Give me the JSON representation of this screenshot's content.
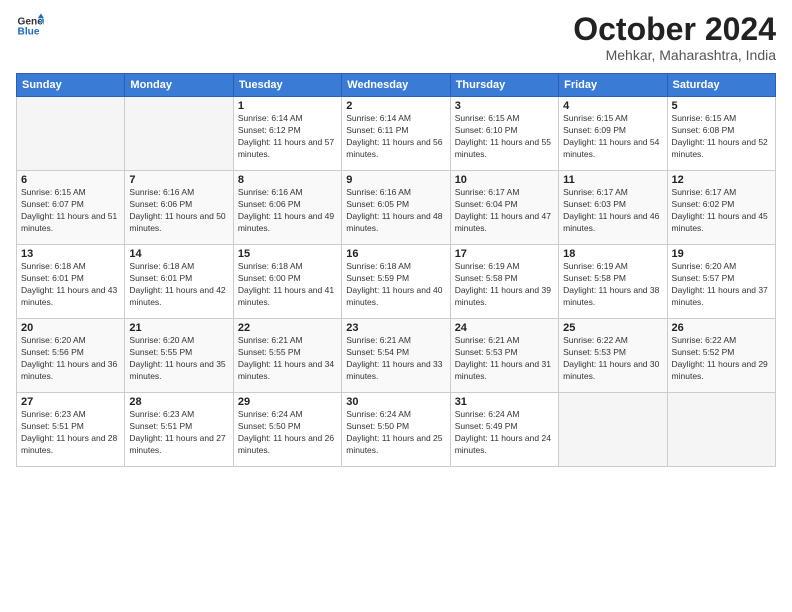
{
  "header": {
    "logo_line1": "General",
    "logo_line2": "Blue",
    "month": "October 2024",
    "location": "Mehkar, Maharashtra, India"
  },
  "weekdays": [
    "Sunday",
    "Monday",
    "Tuesday",
    "Wednesday",
    "Thursday",
    "Friday",
    "Saturday"
  ],
  "weeks": [
    [
      {
        "day": "",
        "info": ""
      },
      {
        "day": "",
        "info": ""
      },
      {
        "day": "1",
        "info": "Sunrise: 6:14 AM\nSunset: 6:12 PM\nDaylight: 11 hours and 57 minutes."
      },
      {
        "day": "2",
        "info": "Sunrise: 6:14 AM\nSunset: 6:11 PM\nDaylight: 11 hours and 56 minutes."
      },
      {
        "day": "3",
        "info": "Sunrise: 6:15 AM\nSunset: 6:10 PM\nDaylight: 11 hours and 55 minutes."
      },
      {
        "day": "4",
        "info": "Sunrise: 6:15 AM\nSunset: 6:09 PM\nDaylight: 11 hours and 54 minutes."
      },
      {
        "day": "5",
        "info": "Sunrise: 6:15 AM\nSunset: 6:08 PM\nDaylight: 11 hours and 52 minutes."
      }
    ],
    [
      {
        "day": "6",
        "info": "Sunrise: 6:15 AM\nSunset: 6:07 PM\nDaylight: 11 hours and 51 minutes."
      },
      {
        "day": "7",
        "info": "Sunrise: 6:16 AM\nSunset: 6:06 PM\nDaylight: 11 hours and 50 minutes."
      },
      {
        "day": "8",
        "info": "Sunrise: 6:16 AM\nSunset: 6:06 PM\nDaylight: 11 hours and 49 minutes."
      },
      {
        "day": "9",
        "info": "Sunrise: 6:16 AM\nSunset: 6:05 PM\nDaylight: 11 hours and 48 minutes."
      },
      {
        "day": "10",
        "info": "Sunrise: 6:17 AM\nSunset: 6:04 PM\nDaylight: 11 hours and 47 minutes."
      },
      {
        "day": "11",
        "info": "Sunrise: 6:17 AM\nSunset: 6:03 PM\nDaylight: 11 hours and 46 minutes."
      },
      {
        "day": "12",
        "info": "Sunrise: 6:17 AM\nSunset: 6:02 PM\nDaylight: 11 hours and 45 minutes."
      }
    ],
    [
      {
        "day": "13",
        "info": "Sunrise: 6:18 AM\nSunset: 6:01 PM\nDaylight: 11 hours and 43 minutes."
      },
      {
        "day": "14",
        "info": "Sunrise: 6:18 AM\nSunset: 6:01 PM\nDaylight: 11 hours and 42 minutes."
      },
      {
        "day": "15",
        "info": "Sunrise: 6:18 AM\nSunset: 6:00 PM\nDaylight: 11 hours and 41 minutes."
      },
      {
        "day": "16",
        "info": "Sunrise: 6:18 AM\nSunset: 5:59 PM\nDaylight: 11 hours and 40 minutes."
      },
      {
        "day": "17",
        "info": "Sunrise: 6:19 AM\nSunset: 5:58 PM\nDaylight: 11 hours and 39 minutes."
      },
      {
        "day": "18",
        "info": "Sunrise: 6:19 AM\nSunset: 5:58 PM\nDaylight: 11 hours and 38 minutes."
      },
      {
        "day": "19",
        "info": "Sunrise: 6:20 AM\nSunset: 5:57 PM\nDaylight: 11 hours and 37 minutes."
      }
    ],
    [
      {
        "day": "20",
        "info": "Sunrise: 6:20 AM\nSunset: 5:56 PM\nDaylight: 11 hours and 36 minutes."
      },
      {
        "day": "21",
        "info": "Sunrise: 6:20 AM\nSunset: 5:55 PM\nDaylight: 11 hours and 35 minutes."
      },
      {
        "day": "22",
        "info": "Sunrise: 6:21 AM\nSunset: 5:55 PM\nDaylight: 11 hours and 34 minutes."
      },
      {
        "day": "23",
        "info": "Sunrise: 6:21 AM\nSunset: 5:54 PM\nDaylight: 11 hours and 33 minutes."
      },
      {
        "day": "24",
        "info": "Sunrise: 6:21 AM\nSunset: 5:53 PM\nDaylight: 11 hours and 31 minutes."
      },
      {
        "day": "25",
        "info": "Sunrise: 6:22 AM\nSunset: 5:53 PM\nDaylight: 11 hours and 30 minutes."
      },
      {
        "day": "26",
        "info": "Sunrise: 6:22 AM\nSunset: 5:52 PM\nDaylight: 11 hours and 29 minutes."
      }
    ],
    [
      {
        "day": "27",
        "info": "Sunrise: 6:23 AM\nSunset: 5:51 PM\nDaylight: 11 hours and 28 minutes."
      },
      {
        "day": "28",
        "info": "Sunrise: 6:23 AM\nSunset: 5:51 PM\nDaylight: 11 hours and 27 minutes."
      },
      {
        "day": "29",
        "info": "Sunrise: 6:24 AM\nSunset: 5:50 PM\nDaylight: 11 hours and 26 minutes."
      },
      {
        "day": "30",
        "info": "Sunrise: 6:24 AM\nSunset: 5:50 PM\nDaylight: 11 hours and 25 minutes."
      },
      {
        "day": "31",
        "info": "Sunrise: 6:24 AM\nSunset: 5:49 PM\nDaylight: 11 hours and 24 minutes."
      },
      {
        "day": "",
        "info": ""
      },
      {
        "day": "",
        "info": ""
      }
    ]
  ]
}
